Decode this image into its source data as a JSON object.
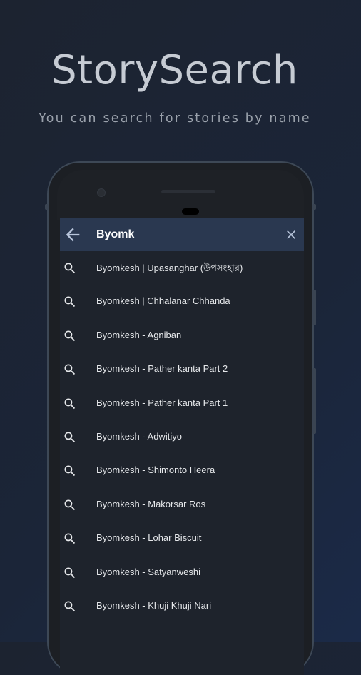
{
  "promo": {
    "title": "StorySearch",
    "subtitle": "You can search for stories by name"
  },
  "search": {
    "query": "Byomk",
    "back_icon": "arrow-back-icon",
    "clear_icon": "close-icon"
  },
  "results": [
    {
      "label": "Byomkesh | Upasanghar (উপসংহার)",
      "icon": "search-icon"
    },
    {
      "label": "Byomkesh | Chhalanar Chhanda",
      "icon": "search-icon"
    },
    {
      "label": "Byomkesh - Agniban",
      "icon": "search-icon"
    },
    {
      "label": "Byomkesh - Pather kanta Part 2",
      "icon": "search-icon"
    },
    {
      "label": "Byomkesh - Pather kanta Part 1",
      "icon": "search-icon"
    },
    {
      "label": "Byomkesh - Adwitiyo",
      "icon": "search-icon"
    },
    {
      "label": "Byomkesh - Shimonto Heera",
      "icon": "search-icon"
    },
    {
      "label": "Byomkesh - Makorsar Ros",
      "icon": "search-icon"
    },
    {
      "label": "Byomkesh - Lohar Biscuit",
      "icon": "search-icon"
    },
    {
      "label": "Byomkesh - Satyanweshi",
      "icon": "search-icon"
    },
    {
      "label": "Byomkesh - Khuji Khuji Nari",
      "icon": "search-icon"
    }
  ],
  "colors": {
    "background": "#1b2538",
    "search_bar": "#2a3850",
    "screen": "#1e232c",
    "text": "#e6e8eb"
  }
}
